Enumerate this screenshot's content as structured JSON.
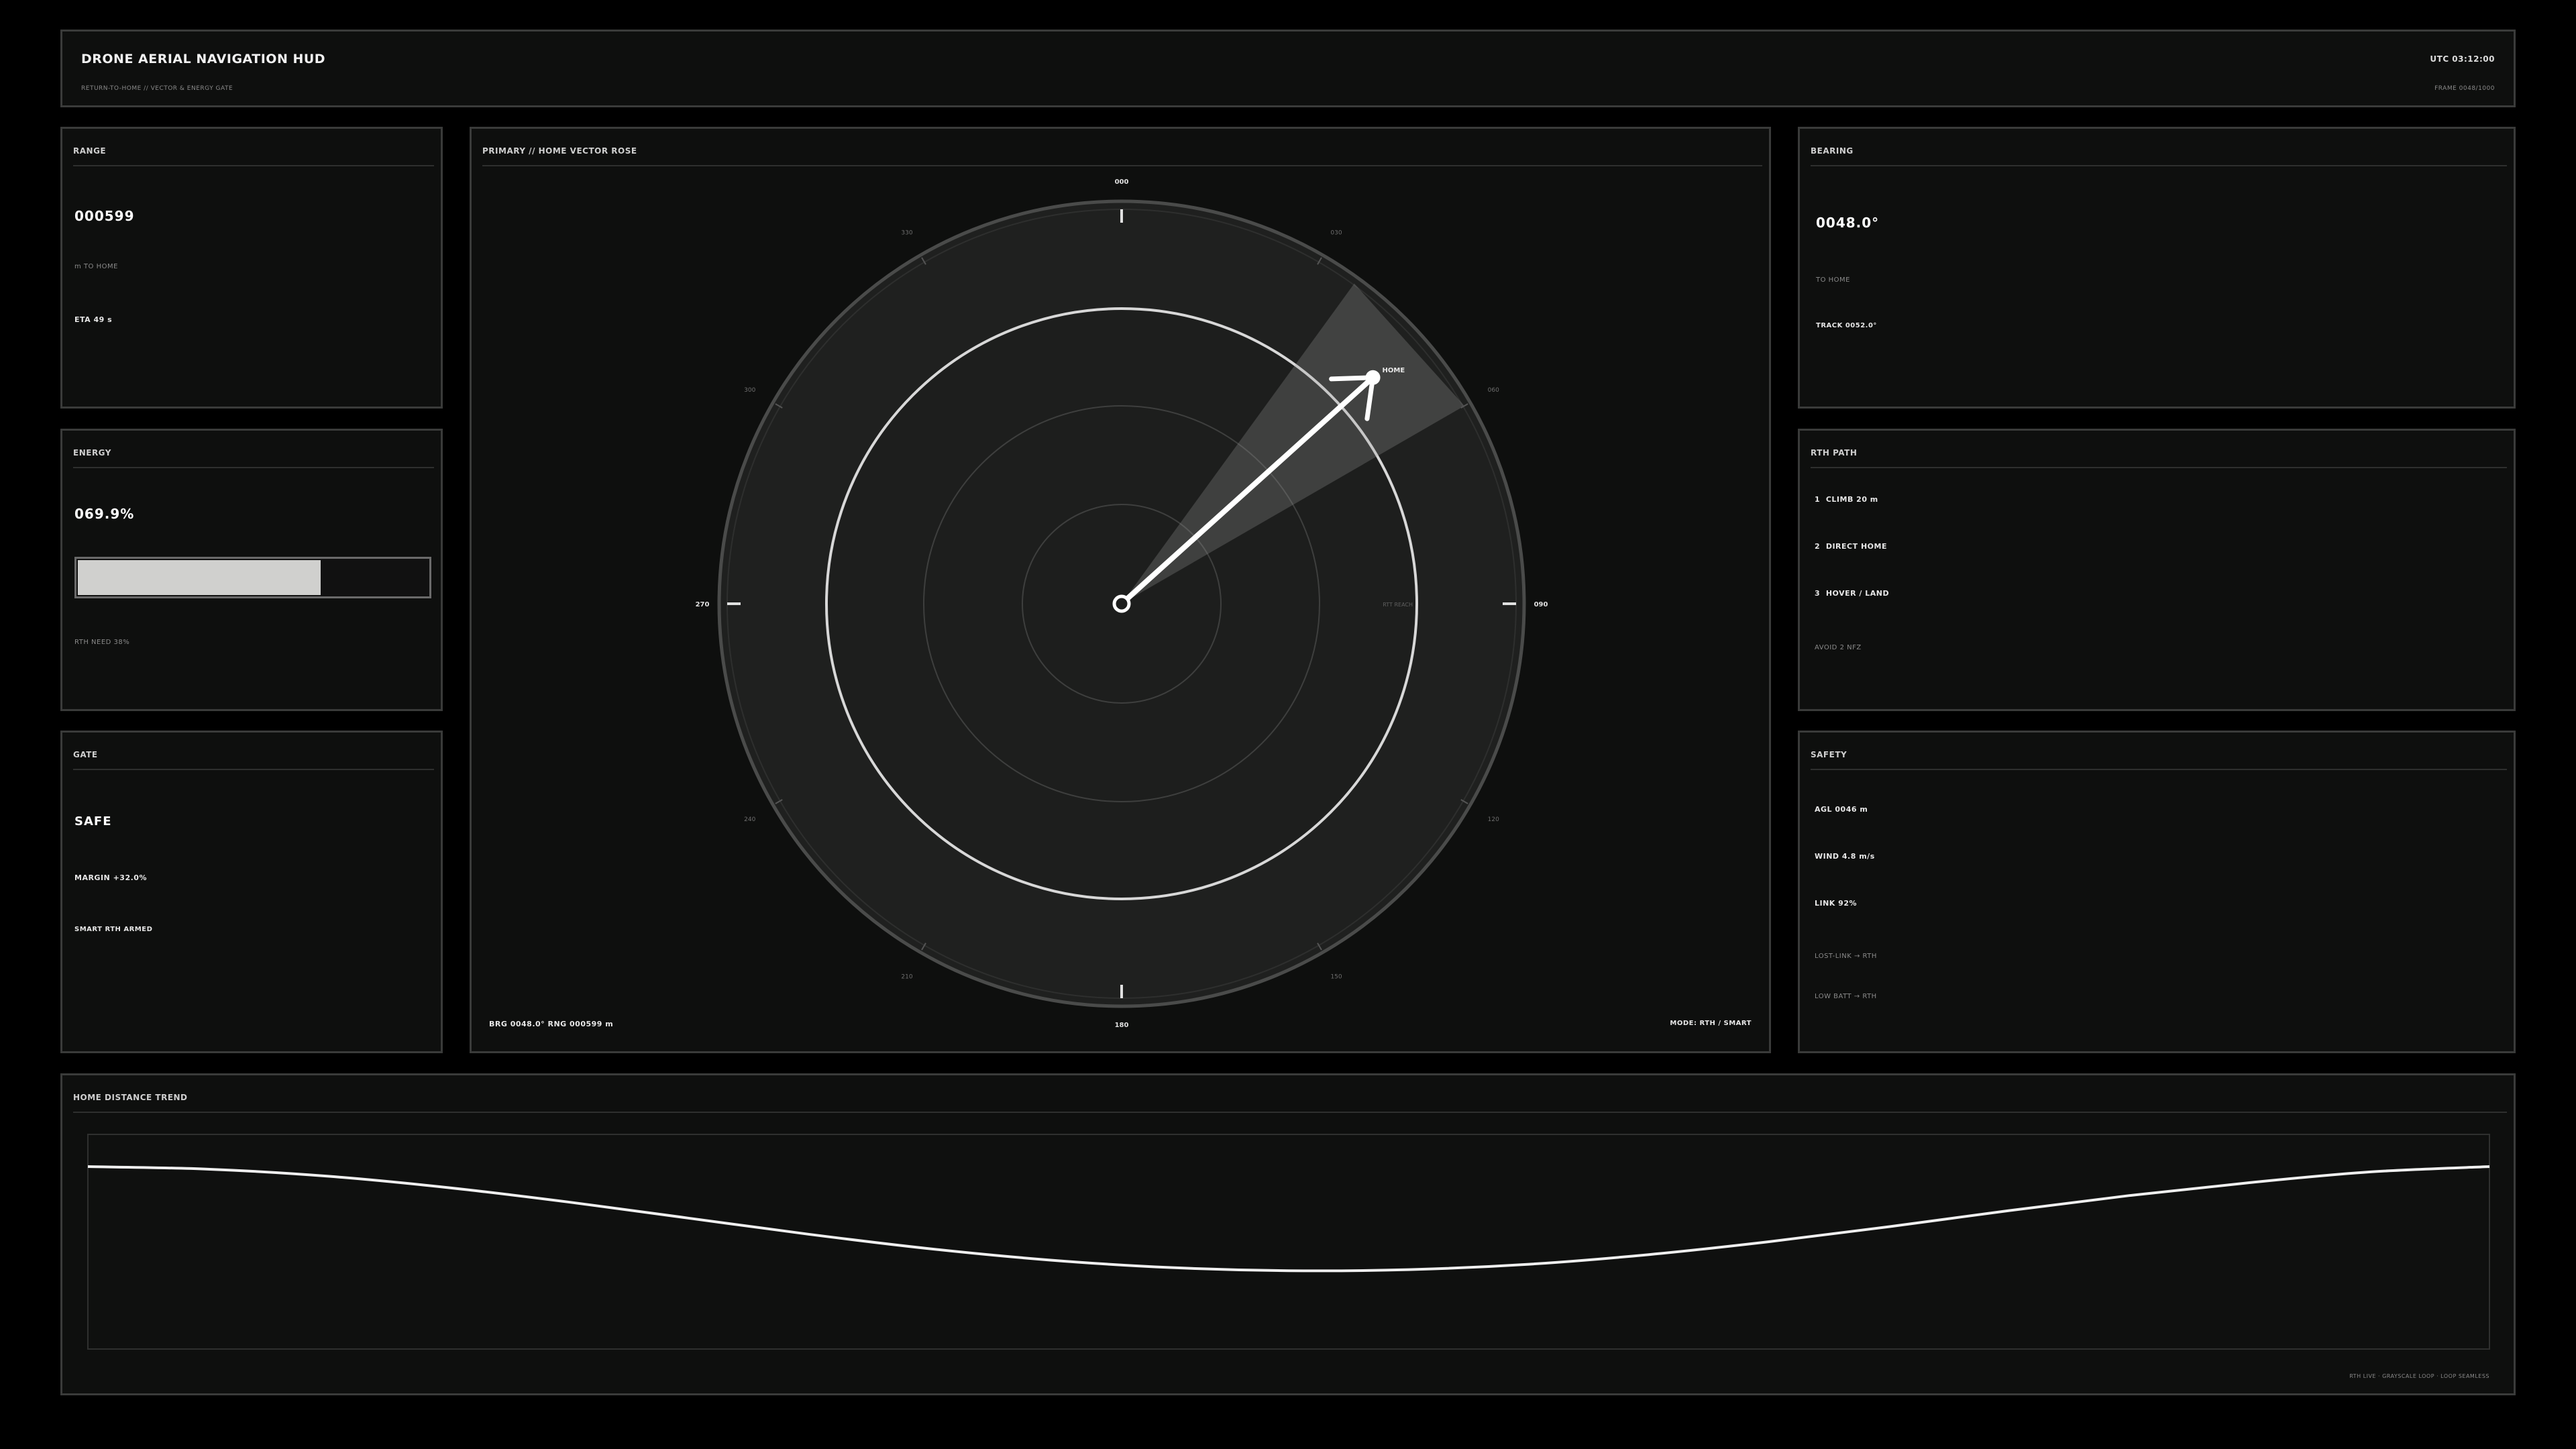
{
  "header": {
    "title": "DRONE AERIAL NAVIGATION HUD",
    "subtitle": "RETURN-TO-HOME // VECTOR & ENERGY GATE",
    "utc": "UTC 03:12:00",
    "frame": "FRAME 0048/1000"
  },
  "range": {
    "title": "RANGE",
    "value": "000599",
    "unit_label": "m TO HOME",
    "eta": "ETA 49 s"
  },
  "energy": {
    "title": "ENERGY",
    "value": "069.9%",
    "level": 0.699,
    "rth_need": "RTH NEED 38%"
  },
  "gate": {
    "title": "GATE",
    "status": "SAFE",
    "margin": "MARGIN +32.0%",
    "smart": "SMART RTH ARMED"
  },
  "primary": {
    "title": "PRIMARY // HOME VECTOR ROSE",
    "cardinal": {
      "n": "000",
      "e": "090",
      "s": "180",
      "w": "270"
    },
    "ticks": [
      {
        "deg": 30,
        "label": "030"
      },
      {
        "deg": 60,
        "label": "060"
      },
      {
        "deg": 120,
        "label": "120"
      },
      {
        "deg": 150,
        "label": "150"
      },
      {
        "deg": 210,
        "label": "210"
      },
      {
        "deg": 240,
        "label": "240"
      },
      {
        "deg": 300,
        "label": "300"
      },
      {
        "deg": 330,
        "label": "330"
      }
    ],
    "home_label": "HOME",
    "reach_label": "RTT REACH",
    "home_bearing_deg": 48,
    "home_range_fraction": 0.84,
    "cone_half_width_deg": 12,
    "readout": "BRG 0048.0°  RNG 000599 m",
    "mode": "MODE: RTH / SMART"
  },
  "bearing": {
    "title": "BEARING",
    "value": "0048.0°",
    "to_home": "TO HOME",
    "track": "TRACK 0052.0°"
  },
  "rth_path": {
    "title": "RTH PATH",
    "steps": [
      {
        "num": "1",
        "label": "CLIMB  20 m"
      },
      {
        "num": "2",
        "label": "DIRECT HOME"
      },
      {
        "num": "3",
        "label": "HOVER / LAND"
      }
    ],
    "avoid": "AVOID 2 NFZ"
  },
  "safety": {
    "title": "SAFETY",
    "agl": "AGL 0046 m",
    "wind": "WIND 4.8 m/s",
    "link": "LINK 92%",
    "lost_link": "LOST-LINK → RTH",
    "low_batt": "LOW BATT → RTH"
  },
  "trend": {
    "title": "HOME DISTANCE TREND",
    "footer": "RTH LIVE · GRAYSCALE LOOP · LOOP SEAMLESS"
  },
  "chart_data": {
    "type": "line",
    "title": "HOME DISTANCE TREND",
    "x": [
      0,
      0.05,
      0.1,
      0.15,
      0.2,
      0.25,
      0.3,
      0.35,
      0.4,
      0.45,
      0.5,
      0.55,
      0.6,
      0.65,
      0.7,
      0.75,
      0.8,
      0.85,
      0.9,
      0.95,
      1.0
    ],
    "values": [
      0.85,
      0.838,
      0.805,
      0.752,
      0.685,
      0.61,
      0.535,
      0.468,
      0.415,
      0.38,
      0.365,
      0.37,
      0.395,
      0.44,
      0.5,
      0.57,
      0.645,
      0.715,
      0.775,
      0.825,
      0.85
    ],
    "ylim": [
      0,
      1
    ],
    "grid": false
  }
}
